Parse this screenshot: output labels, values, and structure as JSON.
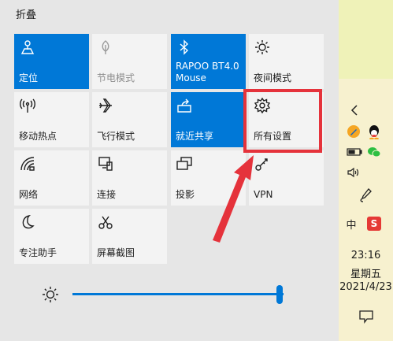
{
  "action_center": {
    "collapse_label": "折叠",
    "tiles": [
      {
        "label": "定位",
        "icon": "location-icon",
        "state": "on"
      },
      {
        "label": "节电模式",
        "icon": "battery-saver-icon",
        "state": "disabled"
      },
      {
        "label": "RAPOO BT4.0\nMouse",
        "icon": "bluetooth-icon",
        "state": "on"
      },
      {
        "label": "夜间模式",
        "icon": "night-light-icon",
        "state": "off"
      },
      {
        "label": "移动热点",
        "icon": "mobile-hotspot-icon",
        "state": "off"
      },
      {
        "label": "飞行模式",
        "icon": "airplane-icon",
        "state": "off"
      },
      {
        "label": "就近共享",
        "icon": "nearby-share-icon",
        "state": "on"
      },
      {
        "label": "所有设置",
        "icon": "settings-gear-icon",
        "state": "off"
      },
      {
        "label": "网络",
        "icon": "network-icon",
        "state": "off"
      },
      {
        "label": "连接",
        "icon": "connect-icon",
        "state": "off"
      },
      {
        "label": "投影",
        "icon": "project-icon",
        "state": "off"
      },
      {
        "label": "VPN",
        "icon": "vpn-icon",
        "state": "off"
      },
      {
        "label": "专注助手",
        "icon": "focus-assist-icon",
        "state": "off"
      },
      {
        "label": "屏幕截图",
        "icon": "screen-snip-icon",
        "state": "off"
      }
    ],
    "brightness": {
      "icon": "brightness-icon",
      "level_fraction": 0.98
    }
  },
  "taskbar": {
    "clock_time": "23:16",
    "clock_day": "星期五",
    "clock_date": "2021/4/23",
    "tray_icons": [
      "chevron-left-icon",
      "pencil-app-icon",
      "qq-icon",
      "battery-icon",
      "volume-icon",
      "pen-icon",
      "ime-icon",
      "wps-icon"
    ],
    "ime_label": "中",
    "wps_label": "S"
  },
  "colors": {
    "accent": "#0078d7",
    "highlight": "#e5323b",
    "tile_off": "#f3f3f3",
    "panel": "#e6e6e6"
  }
}
